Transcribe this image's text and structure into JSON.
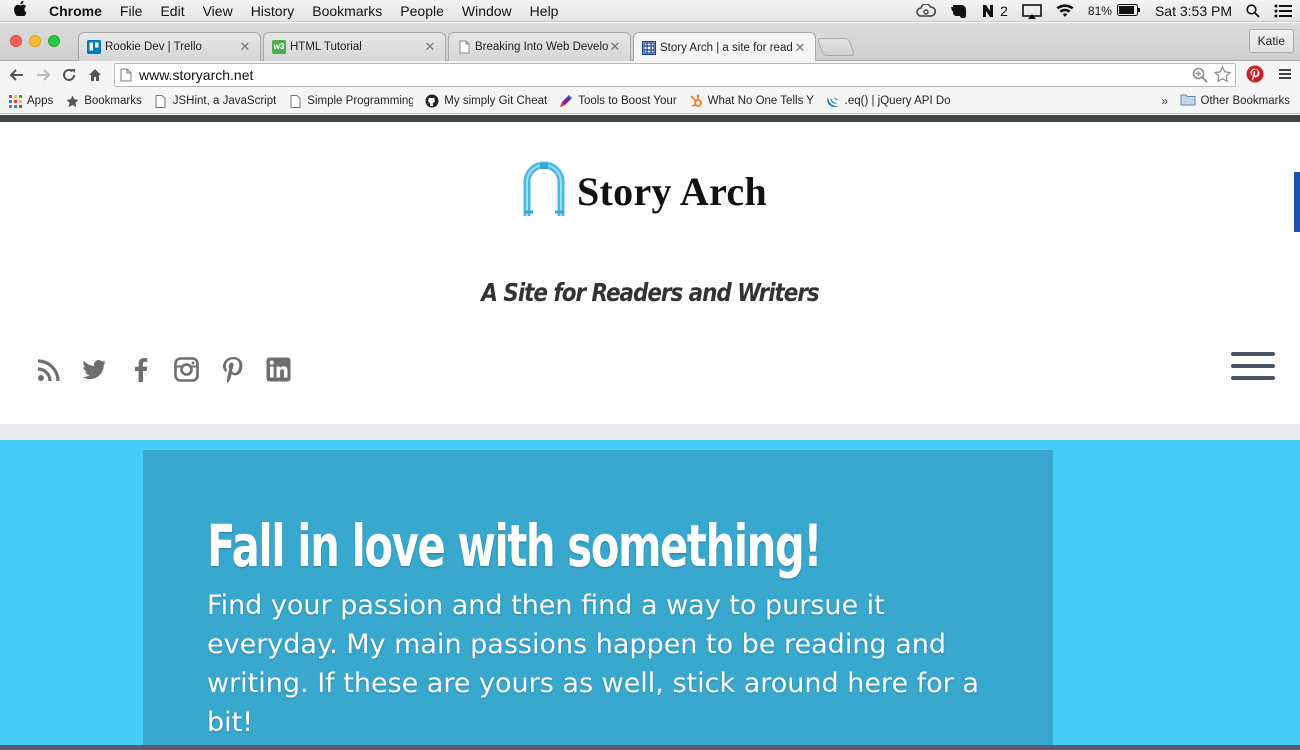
{
  "menubar": {
    "app_name": "Chrome",
    "items": [
      "File",
      "Edit",
      "View",
      "History",
      "Bookmarks",
      "People",
      "Window",
      "Help"
    ],
    "status": {
      "notifications": "2",
      "battery": "81%",
      "clock": "Sat 3:53 PM"
    }
  },
  "tabs": [
    {
      "title": "Rookie Dev | Trello",
      "favicon": "trello-icon",
      "color": "#0079bf"
    },
    {
      "title": "HTML Tutorial",
      "favicon": "w3schools-icon",
      "color": "#4caf50"
    },
    {
      "title": "Breaking Into Web Develop",
      "favicon": "page-icon",
      "color": "#cccccc"
    },
    {
      "title": "Story Arch | a site for reader",
      "favicon": "storyarch-icon",
      "color": "#1a3d8f"
    }
  ],
  "profile_name": "Katie",
  "address_bar": {
    "url": "www.storyarch.net"
  },
  "bookmarks": [
    {
      "label": "Apps",
      "icon": "apps-grid-icon"
    },
    {
      "label": "Bookmarks",
      "icon": "star-icon"
    },
    {
      "label": "JSHint, a JavaScript",
      "icon": "page-icon"
    },
    {
      "label": "Simple Programming",
      "icon": "page-icon"
    },
    {
      "label": "My simply Git Cheat",
      "icon": "github-icon"
    },
    {
      "label": "Tools to Boost Your",
      "icon": "pen-icon"
    },
    {
      "label": "What No One Tells Y",
      "icon": "hubspot-icon"
    },
    {
      "label": ".eq() | jQuery API Do",
      "icon": "jquery-icon"
    }
  ],
  "bookmarks_more": "»",
  "other_bookmarks": "Other Bookmarks",
  "site": {
    "logo_text": "Story Arch",
    "tagline": "A Site for Readers and Writers",
    "social_icons": [
      "rss-icon",
      "twitter-icon",
      "facebook-icon",
      "instagram-icon",
      "pinterest-icon",
      "linkedin-icon"
    ],
    "hero": {
      "title": "Fall in love with something!",
      "body": "Find your passion and then find a way to pursue it everyday. My main passions happen to be reading and writing. If these are yours as well, stick around here for a bit!"
    }
  },
  "colors": {
    "hero_bg": "#45cdf7",
    "hero_box": "#38a8cf",
    "arch_blue": "#4bb8e6",
    "accent_pinterest": "#cb2027"
  }
}
